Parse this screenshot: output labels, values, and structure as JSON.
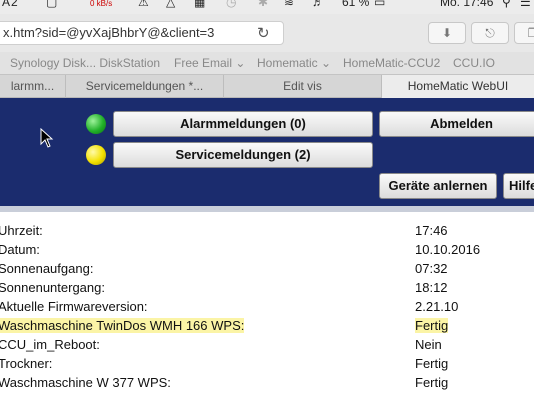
{
  "menubar": {
    "items": [
      "A 2",
      "0 kB/s",
      "61 %",
      "Mo. 17:46"
    ],
    "clock": "Mo. 17:46",
    "battery": "61 %"
  },
  "urlbar": {
    "url": "x.htm?sid=@yvXajBhbrY@&client=3"
  },
  "bookmarks": [
    {
      "label": "Synology Disk... DiskStation"
    },
    {
      "label": "Free Email ⌄"
    },
    {
      "label": "Homematic ⌄"
    },
    {
      "label": "HomeMatic-CCU2"
    },
    {
      "label": "CCU.IO"
    }
  ],
  "tabs": [
    {
      "label": "larmm..."
    },
    {
      "label": "Servicemeldungen *..."
    },
    {
      "label": "Edit vis"
    },
    {
      "label": "HomeMatic WebUI"
    }
  ],
  "banner": {
    "alarm_label": "Alarmmeldungen (0)",
    "service_label": "Servicemeldungen (2)",
    "logout_label": "Abmelden",
    "pair_label": "Geräte anlernen",
    "help_label": "Hilfe",
    "status_colors": {
      "alarm": "#22b12a",
      "service": "#f3e100"
    }
  },
  "info": [
    {
      "label": "Uhrzeit:",
      "value": "17:46"
    },
    {
      "label": "Datum:",
      "value": "10.10.2016"
    },
    {
      "label": "Sonnenaufgang:",
      "value": "07:32"
    },
    {
      "label": "Sonnenuntergang:",
      "value": "18:12"
    },
    {
      "label": "Aktuelle Firmwareversion:",
      "value": "2.21.10"
    },
    {
      "label": "Waschmaschine TwinDos WMH 166 WPS:",
      "value": "Fertig"
    },
    {
      "label": "CCU_im_Reboot:",
      "value": "Nein"
    },
    {
      "label": "Trockner:",
      "value": "Fertig"
    },
    {
      "label": "Waschmaschine W 377 WPS:",
      "value": "Fertig"
    }
  ]
}
